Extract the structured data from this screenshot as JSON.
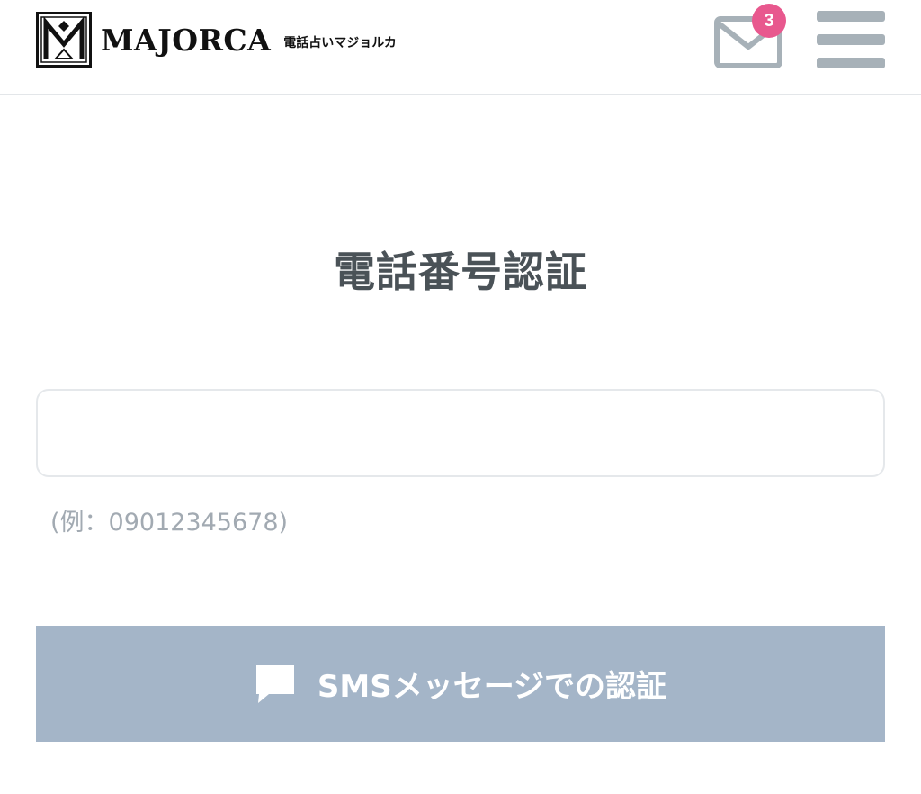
{
  "header": {
    "logo_text": "MAJORCA",
    "logo_subtitle": "電話占いマジョルカ",
    "mail_badge_count": "3"
  },
  "main": {
    "title": "電話番号認証",
    "phone_input": {
      "value": "",
      "placeholder": ""
    },
    "example_hint": "(例：09012345678)",
    "sms_button_label": "SMSメッセージでの認証"
  },
  "colors": {
    "badge": "#e8588e",
    "button": "#a4b5c8",
    "icon_gray": "#a7b1b8",
    "title": "#4a5257"
  },
  "icons": {
    "logo": "majorca-logo-icon",
    "mail": "mail-icon",
    "menu": "hamburger-menu-icon",
    "sms": "speech-bubble-icon"
  }
}
